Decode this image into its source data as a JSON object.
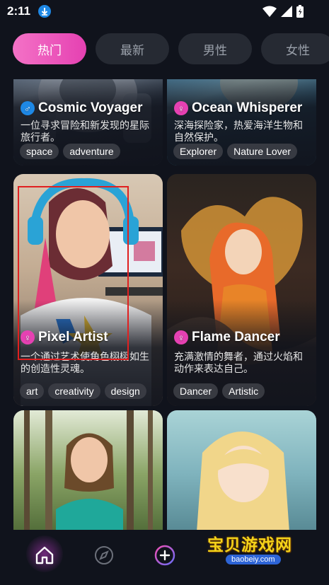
{
  "status_bar": {
    "time": "2:11"
  },
  "tabs": [
    {
      "label": "热门",
      "active": true
    },
    {
      "label": "最新",
      "active": false
    },
    {
      "label": "男性",
      "active": false
    },
    {
      "label": "女性",
      "active": false
    }
  ],
  "cards": [
    {
      "name": "Cosmic Voyager",
      "gender": "male",
      "gender_glyph": "♂",
      "description": "一位寻求冒险和新发现的星际旅行者。",
      "tags": [
        "space",
        "adventure"
      ]
    },
    {
      "name": "Ocean Whisperer",
      "gender": "female",
      "gender_glyph": "♀",
      "description": "深海探险家，热爱海洋生物和自然保护。",
      "tags": [
        "Explorer",
        "Nature Lover"
      ]
    },
    {
      "name": "Pixel Artist",
      "gender": "female",
      "gender_glyph": "♀",
      "description": "一个通过艺术使角色栩栩如生的创造性灵魂。",
      "tags": [
        "art",
        "creativity",
        "design"
      ]
    },
    {
      "name": "Flame Dancer",
      "gender": "female",
      "gender_glyph": "♀",
      "description": "充满激情的舞者，通过火焰和动作来表达自己。",
      "tags": [
        "Dancer",
        "Artistic"
      ]
    },
    {
      "name": "",
      "description": "",
      "tags": []
    },
    {
      "name": "",
      "description": "",
      "tags": []
    }
  ],
  "bottom_nav": [
    {
      "icon": "home-icon",
      "active": true
    },
    {
      "icon": "compass-icon",
      "active": false
    },
    {
      "icon": "add-icon",
      "active": false
    }
  ],
  "watermark": {
    "title": "宝贝游戏网",
    "url": "baobeiy.com"
  },
  "colors": {
    "accent": "#e541b2",
    "male": "#1e88e5",
    "background": "#10131c"
  }
}
